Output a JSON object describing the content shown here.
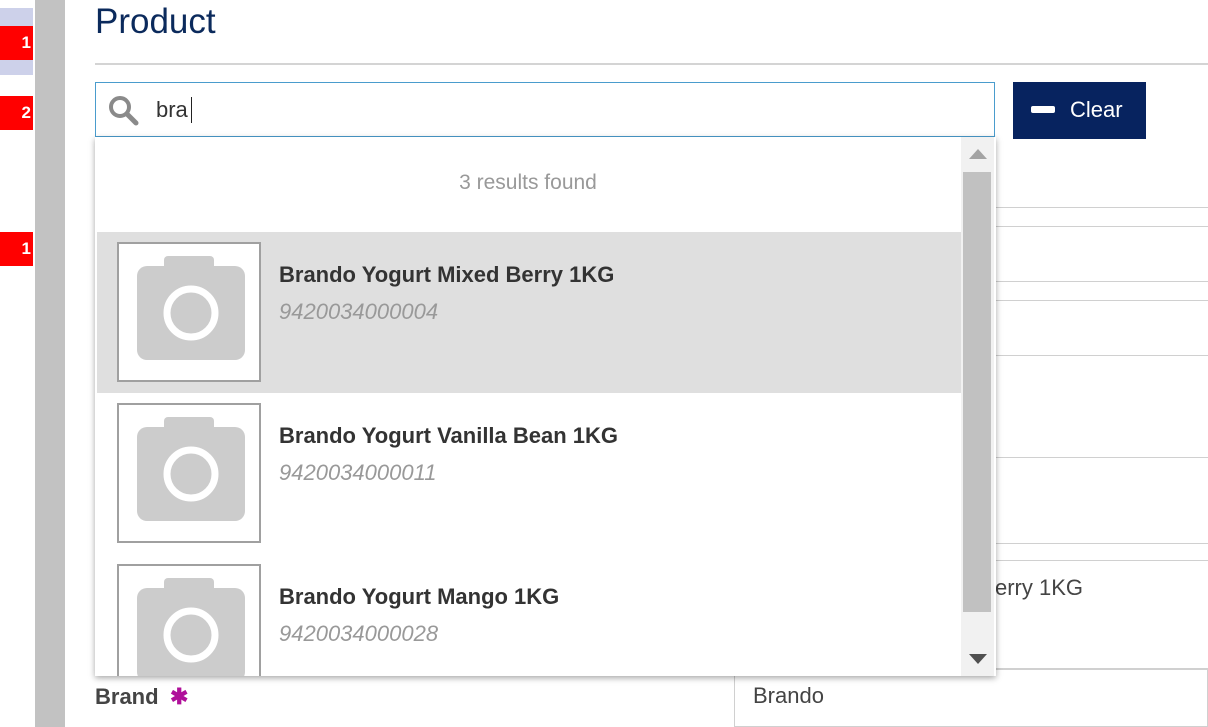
{
  "page": {
    "title": "Product"
  },
  "sidebar": {
    "badges": [
      "1",
      "2",
      "1"
    ]
  },
  "search": {
    "value": "bra",
    "placeholder": ""
  },
  "clear_button": {
    "label": "Clear"
  },
  "dropdown": {
    "results_text": "3 results found",
    "results": [
      {
        "name": "Brando Yogurt Mixed Berry 1KG",
        "code": "9420034000004",
        "selected": true
      },
      {
        "name": "Brando Yogurt Vanilla Bean 1KG",
        "code": "9420034000011",
        "selected": false
      },
      {
        "name": "Brando Yogurt Mango 1KG",
        "code": "9420034000028",
        "selected": false
      }
    ]
  },
  "form": {
    "partial_name_text": "erry 1KG",
    "brand_label": "Brand",
    "brand_required_mark": "✱",
    "brand_value": "Brando"
  },
  "colors": {
    "accent": "#07235f",
    "title": "#0b2a5c",
    "badge": "#ff0000",
    "required": "#b0109a"
  }
}
